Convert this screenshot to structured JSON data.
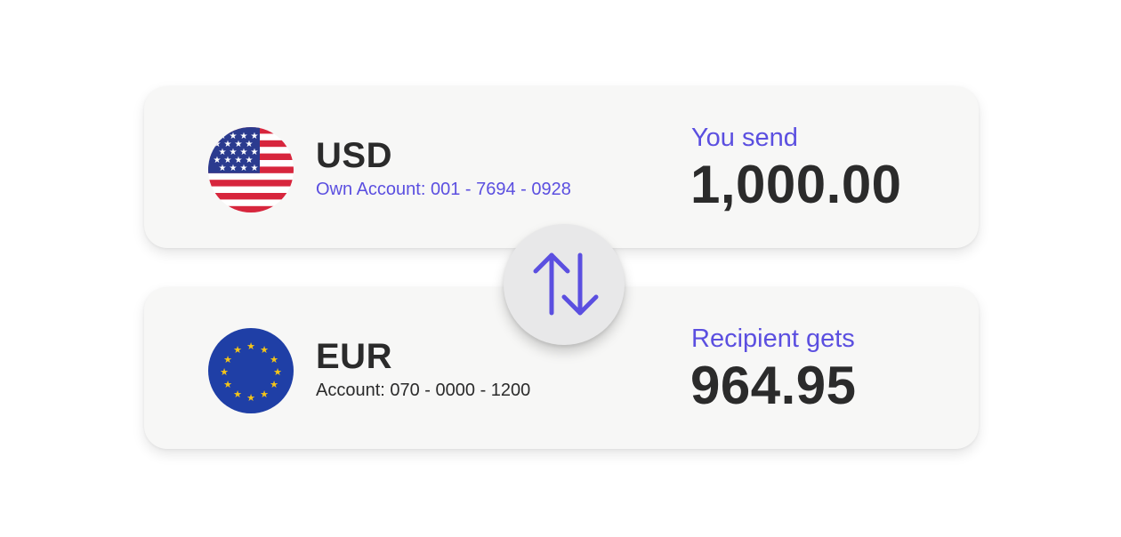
{
  "send": {
    "flag_icon": "us-flag-icon",
    "currency": "USD",
    "account": "Own Account: 001 - 7694 - 0928",
    "caption": "You send",
    "amount": "1,000.00"
  },
  "receive": {
    "flag_icon": "eu-flag-icon",
    "currency": "EUR",
    "account": "Account: 070 - 0000 - 1200",
    "caption": "Recipient gets",
    "amount": "964.95"
  },
  "swap": {
    "icon": "swap-arrows-icon"
  },
  "colors": {
    "accent": "#5b4fe0",
    "text": "#2b2b2b",
    "card_background": "#f7f7f6",
    "swap_background": "#e8e8e9",
    "us_red": "#d7263d",
    "us_blue": "#2b3b8f",
    "eu_blue": "#1f3fa6",
    "eu_star": "#f5c518"
  }
}
